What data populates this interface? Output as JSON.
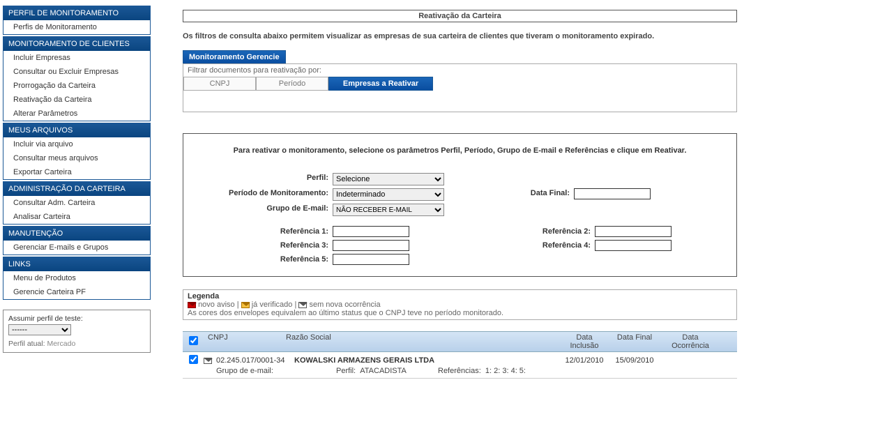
{
  "sidebar": {
    "sections": [
      {
        "header": "PERFIL DE MONITORAMENTO",
        "items": [
          "Perfis de Monitoramento"
        ]
      },
      {
        "header": "MONITORAMENTO DE CLIENTES",
        "items": [
          "Incluir Empresas",
          "Consultar ou Excluir Empresas",
          "Prorrogação da Carteira",
          "Reativação da Carteira",
          "Alterar Parâmetros"
        ]
      },
      {
        "header": "MEUS ARQUIVOS",
        "items": [
          "Incluir via arquivo",
          "Consultar meus arquivos",
          "Exportar Carteira"
        ]
      },
      {
        "header": "ADMINISTRAÇÃO DA CARTEIRA",
        "items": [
          "Consultar Adm. Carteira",
          "Analisar Carteira"
        ]
      },
      {
        "header": "MANUTENÇÃO",
        "items": [
          "Gerenciar E-mails e Grupos"
        ]
      },
      {
        "header": "LINKS",
        "items": [
          "Menu de Produtos",
          "Gerencie Carteira PF"
        ]
      }
    ]
  },
  "profile": {
    "label": "Assumir perfil de teste:",
    "select": "------",
    "current_label": "Perfil atual:",
    "current_value": "Mercado"
  },
  "page": {
    "title": "Reativação da Carteira",
    "description": "Os filtros de consulta abaixo permitem visualizar as empresas de sua carteira de clientes que tiveram o monitoramento expirado.",
    "tab_section_label": "Monitoramento Gerencie",
    "filter_label": "Filtrar documentos para reativação por:",
    "tabs": [
      "CNPJ",
      "Período",
      "Empresas a Reativar"
    ],
    "active_tab": 2
  },
  "form": {
    "instruction": "Para reativar o monitoramento, selecione os parâmetros Perfil, Período, Grupo de E-mail e Referências e clique em Reativar.",
    "labels": {
      "perfil": "Perfil:",
      "periodo": "Período de Monitoramento:",
      "grupo": "Grupo de E-mail:",
      "data_final": "Data Final:",
      "ref1": "Referência 1:",
      "ref2": "Referência 2:",
      "ref3": "Referência 3:",
      "ref4": "Referência 4:",
      "ref5": "Referência 5:"
    },
    "values": {
      "perfil": "Selecione",
      "periodo": "Indeterminado",
      "grupo": "NÃO RECEBER E-MAIL"
    }
  },
  "legend": {
    "title": "Legenda",
    "novo_aviso": "novo aviso",
    "ja_verificado": "já verificado",
    "sem_nova": "sem nova ocorrência",
    "note": "As cores dos envelopes equivalem ao último status que o CNPJ teve no período monitorado."
  },
  "table": {
    "headers": {
      "cnpj": "CNPJ",
      "razao": "Razão Social",
      "data_inclusao": "Data Inclusão",
      "data_final": "Data Final",
      "data_ocorrencia": "Data Ocorrência"
    },
    "row": {
      "cnpj": "02.245.017/0001-34",
      "razao": "KOWALSKI ARMAZENS GERAIS LTDA",
      "data_inclusao": "12/01/2010",
      "data_final": "15/09/2010",
      "grupo_label": "Grupo de e-mail:",
      "perfil_label": "Perfil:",
      "perfil_value": "ATACADISTA",
      "ref_label": "Referências:",
      "ref_values": "1:   2:   3:   4:   5:"
    }
  }
}
